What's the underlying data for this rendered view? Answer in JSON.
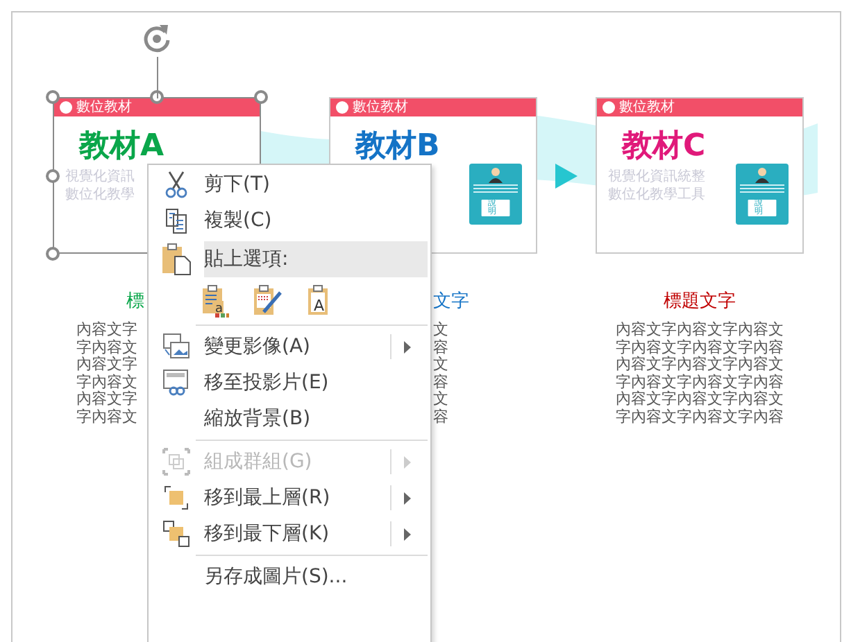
{
  "cards": [
    {
      "header": "數位教材",
      "title": "教材A",
      "color": "#0aa64a",
      "selected": true,
      "subtitles": [
        "視覺化資訊",
        "數位化教學"
      ]
    },
    {
      "header": "數位教材",
      "title": "教材B",
      "color": "#1473c6",
      "selected": false,
      "panel": {
        "button": "說明"
      }
    },
    {
      "header": "數位教材",
      "title": "教材C",
      "color": "#e0197a",
      "selected": false,
      "subtitles": [
        "視覺化資訊統整",
        "數位化教學工具"
      ],
      "panel": {
        "button": "說明"
      }
    }
  ],
  "columns": [
    {
      "title": "標",
      "color": "#0aa64a",
      "lines": [
        "內容文字",
        "字內容文",
        "內容文字",
        "字內容文",
        "內容文字",
        "字內容文"
      ]
    },
    {
      "title": "文字",
      "color": "#1473c6",
      "lines": [
        "文",
        "容",
        "文",
        "容",
        "文",
        "容"
      ]
    },
    {
      "title": "標題文字",
      "color": "#c00000",
      "lines": [
        "內容文字內容文字內容文",
        "字內容文字內容文字內容",
        "內容文字內容文字內容文",
        "字內容文字內容文字內容",
        "內容文字內容文字內容文",
        "字內容文字內容文字內容"
      ]
    }
  ],
  "context_menu": [
    {
      "kind": "item",
      "label": "剪下(T)",
      "disabled": false,
      "submenu": false
    },
    {
      "kind": "item",
      "label": "複製(C)",
      "disabled": false,
      "submenu": false
    },
    {
      "kind": "header",
      "label": "貼上選項:"
    },
    {
      "kind": "paste-options",
      "letters": [
        "a",
        "A"
      ]
    },
    {
      "kind": "separator"
    },
    {
      "kind": "item",
      "label": "變更影像(A)",
      "disabled": false,
      "submenu": true
    },
    {
      "kind": "item",
      "label": "移至投影片(E)",
      "disabled": false,
      "submenu": false
    },
    {
      "kind": "item",
      "label": "縮放背景(B)",
      "disabled": false,
      "submenu": false
    },
    {
      "kind": "separator"
    },
    {
      "kind": "item",
      "label": "組成群組(G)",
      "disabled": true,
      "submenu": true
    },
    {
      "kind": "item",
      "label": "移到最上層(R)",
      "disabled": false,
      "submenu": true
    },
    {
      "kind": "item",
      "label": "移到最下層(K)",
      "disabled": false,
      "submenu": true
    },
    {
      "kind": "separator"
    },
    {
      "kind": "item",
      "label": "另存成圖片(S)...",
      "disabled": false,
      "submenu": false
    }
  ]
}
